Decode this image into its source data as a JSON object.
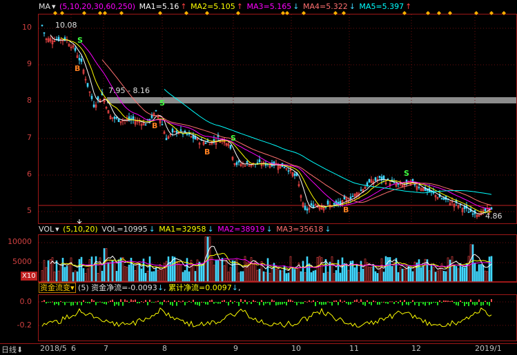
{
  "price_panel": {
    "indicator_name": "MA",
    "params": "(5,10,20,30,60,250)",
    "ma1": "MA1=5.16",
    "ma2": "MA2=5.105",
    "ma3": "MA3=5.165",
    "ma4": "MA4=5.322",
    "ma5": "MA5=5.397",
    "up_arrow": "↑",
    "down_arrow": "↓",
    "y_ticks": [
      "10",
      "9",
      "8",
      "7",
      "6",
      "5"
    ],
    "high_label": "10.08",
    "low_label": "4.86",
    "range_label": "7.95 - 8.16",
    "buy_marker": "B",
    "sell_marker": "S"
  },
  "volume_panel": {
    "indicator_name": "VOL",
    "params": "(5,10,20)",
    "vol": "VOL=10995",
    "ma1": "MA1=32958",
    "ma2": "MA2=38919",
    "ma3": "MA3=35618",
    "y_ticks": [
      "10000",
      "5000"
    ],
    "unit": "X10"
  },
  "flow_panel": {
    "indicator_name": "资金流变",
    "params": "(5)",
    "net": "资金净流=-0.0093",
    "cumulative": "累计净流=0.0097",
    "trail": ",",
    "y_ticks": [
      "0.0",
      "-0.2"
    ]
  },
  "x_axis": {
    "period_label": "日线",
    "labels": [
      "2018/5",
      "6",
      "7",
      "8",
      "9",
      "10",
      "11",
      "12",
      "2019/1"
    ]
  },
  "colors": {
    "ma1": "#ffffff",
    "ma2": "#ffff00",
    "ma3": "#ff00ff",
    "ma4": "#ff7070",
    "ma5": "#00ffff",
    "up": "#ff4a4a",
    "down": "#40d8ff",
    "grid": "#a01818"
  }
}
